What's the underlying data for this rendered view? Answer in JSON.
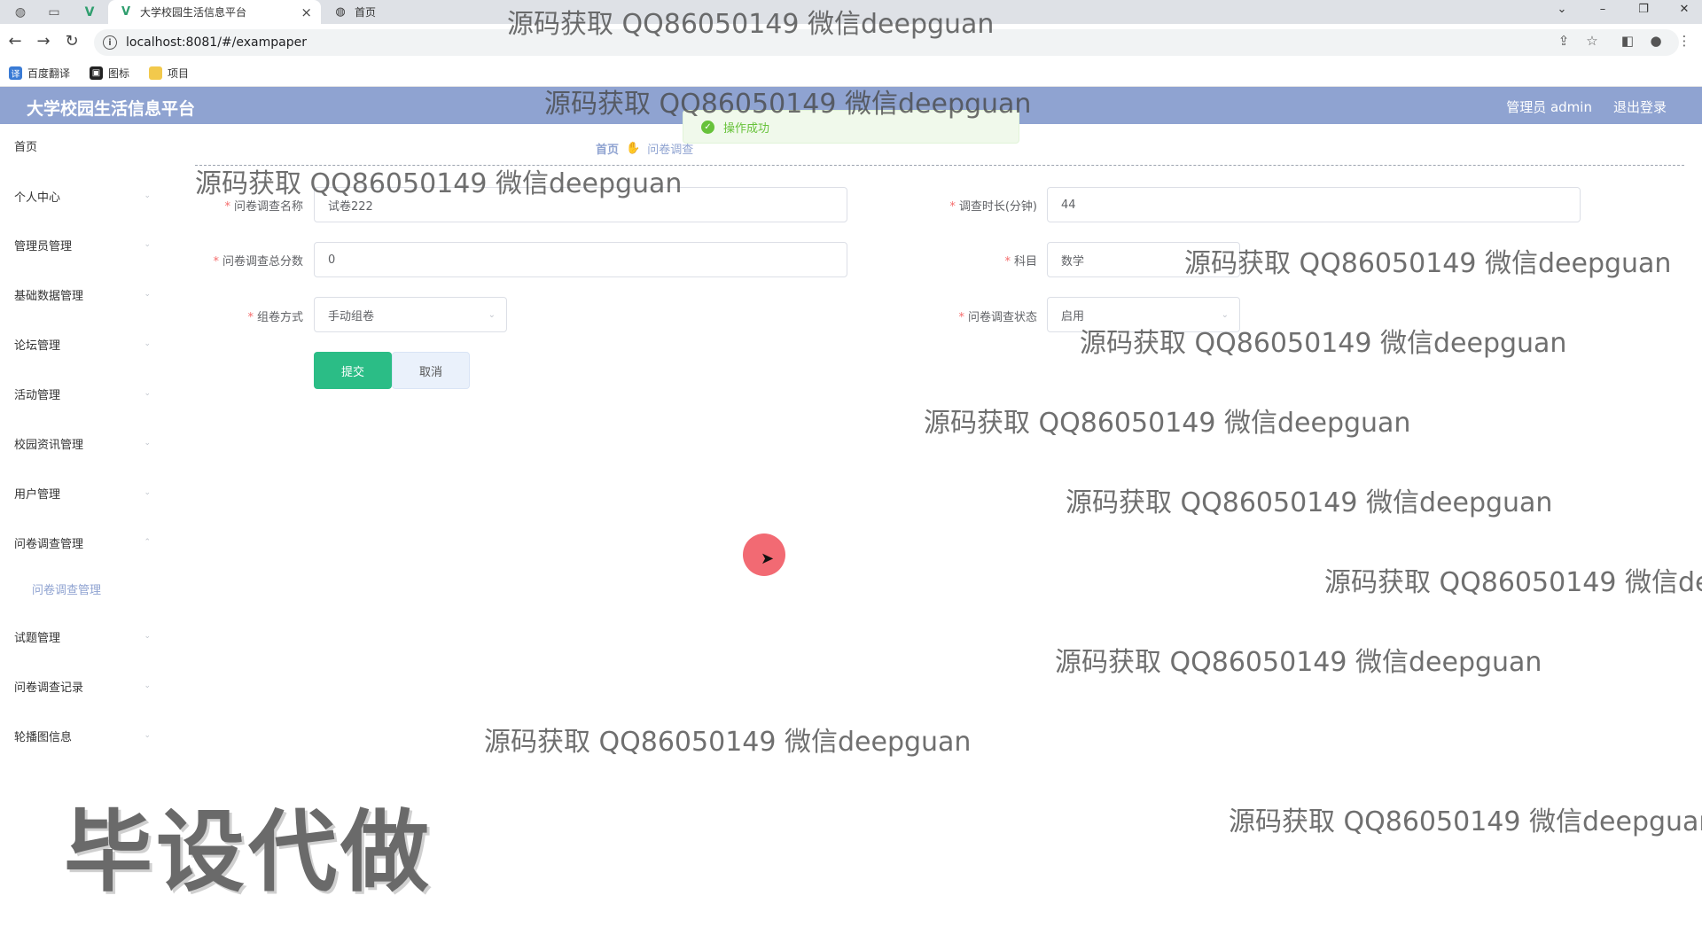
{
  "browser": {
    "tabs": [
      {
        "title": "大学校园生活信息平台",
        "active": true
      },
      {
        "title": "首页",
        "active": false
      }
    ],
    "url": "localhost:8081/#/exampaper",
    "bookmarks": [
      "百度翻译",
      "图标",
      "项目"
    ]
  },
  "header": {
    "title": "大学校园生活信息平台",
    "user_label": "管理员 admin",
    "logout_label": "退出登录"
  },
  "toast": {
    "message": "操作成功"
  },
  "sidebar": {
    "items": [
      {
        "label": "首页",
        "has_arrow": false
      },
      {
        "label": "个人中心",
        "has_arrow": true
      },
      {
        "label": "管理员管理",
        "has_arrow": true
      },
      {
        "label": "基础数据管理",
        "has_arrow": true
      },
      {
        "label": "论坛管理",
        "has_arrow": true
      },
      {
        "label": "活动管理",
        "has_arrow": true
      },
      {
        "label": "校园资讯管理",
        "has_arrow": true
      },
      {
        "label": "用户管理",
        "has_arrow": true
      },
      {
        "label": "问卷调查管理",
        "has_arrow": true
      },
      {
        "label": "试题管理",
        "has_arrow": true
      },
      {
        "label": "问卷调查记录",
        "has_arrow": true
      },
      {
        "label": "轮播图信息",
        "has_arrow": true
      }
    ],
    "submenu_label": "问卷调查管理"
  },
  "breadcrumb": {
    "home": "首页",
    "current": "问卷调查"
  },
  "form": {
    "name": {
      "label": "问卷调查名称",
      "value": "试卷222"
    },
    "duration": {
      "label": "调查时长(分钟)",
      "value": "44"
    },
    "total_score": {
      "label": "问卷调查总分数",
      "value": "0"
    },
    "subject": {
      "label": "科目",
      "value": "数学"
    },
    "compose_method": {
      "label": "组卷方式",
      "value": "手动组卷"
    },
    "status": {
      "label": "问卷调查状态",
      "value": "启用"
    },
    "submit_label": "提交",
    "cancel_label": "取消"
  },
  "watermark": {
    "text": "源码获取 QQ86050149 微信deepguan",
    "clipped_text": "源码获取 QQ86050149 微信de",
    "big_text": "毕设代做"
  },
  "colors": {
    "header_bg": "#8fa3d1",
    "submit_bg": "#2bbd86",
    "required": "#f56c6c",
    "success": "#67c23a"
  }
}
